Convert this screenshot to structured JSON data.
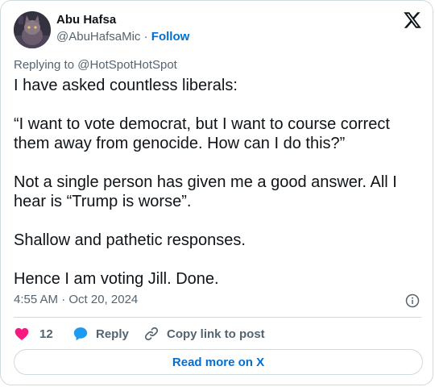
{
  "author": {
    "name": "Abu Hafsa",
    "handle": "@AbuHafsaMic",
    "separator": " · ",
    "follow_label": "Follow"
  },
  "tweet": {
    "replying_to_prefix": "Replying to ",
    "replying_to_handle": "@HotSpotHotSpot",
    "paragraphs": [
      "I have asked countless liberals:",
      "“I want to vote democrat, but I want to course correct them away from genocide. How can I do this?”",
      "Not a single person has given me a good answer. All I hear is “Trump is worse”.",
      "Shallow and pathetic responses.",
      "Hence I am voting Jill. Done."
    ],
    "timestamp": "4:55 AM · Oct 20, 2024"
  },
  "actions": {
    "like_count": "12",
    "reply_label": "Reply",
    "copy_link_label": "Copy link to post"
  },
  "footer": {
    "read_more_label": "Read more on X"
  },
  "icons": {
    "logo": "x-logo-icon",
    "info": "info-icon",
    "like": "heart-icon",
    "reply": "speech-bubble-icon",
    "copy": "link-icon"
  },
  "colors": {
    "link": "#006fd6",
    "heart": "#f91880",
    "reply_bubble": "#1d9bf0",
    "muted_text": "#536471",
    "border": "#cfd9de"
  }
}
